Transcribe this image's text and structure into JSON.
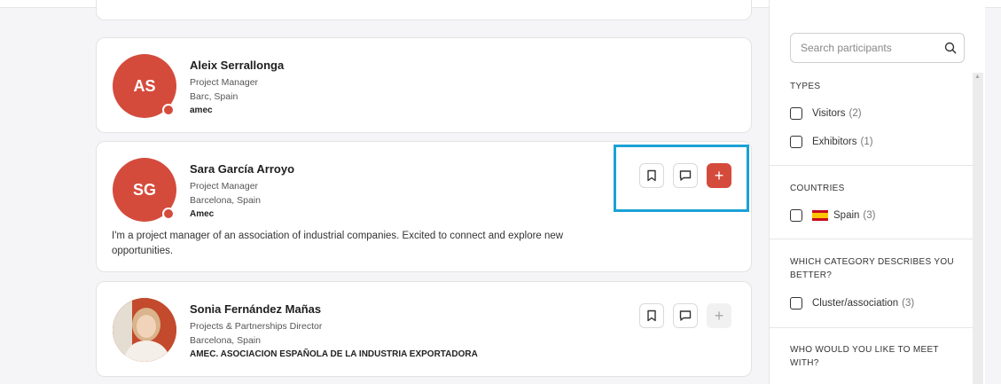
{
  "participants": [
    {
      "initials": "AS",
      "name": "Aleix Serrallonga",
      "title": "Project Manager",
      "location": "Barc, Spain",
      "company": "amec"
    },
    {
      "initials": "SG",
      "name": "Sara García Arroyo",
      "title": "Project Manager",
      "location": "Barcelona, Spain",
      "company": "Amec",
      "bio": "I'm a project manager of an association of industrial companies. Excited to connect and explore new opportunities."
    },
    {
      "name": "Sonia Fernández Mañas",
      "title": "Projects & Partnerships Director",
      "location": "Barcelona, Spain",
      "company": "AMEC. ASOCIACION ESPAÑOLA DE LA INDUSTRIA EXPORTADORA"
    }
  ],
  "actions": {
    "add_symbol": "+"
  },
  "filters": {
    "search_placeholder": "Search participants",
    "types": {
      "title": "TYPES",
      "options": [
        {
          "label": "Visitors",
          "count": "(2)"
        },
        {
          "label": "Exhibitors",
          "count": "(1)"
        }
      ]
    },
    "countries": {
      "title": "COUNTRIES",
      "options": [
        {
          "label": "Spain",
          "count": "(3)"
        }
      ]
    },
    "category": {
      "title": "WHICH CATEGORY DESCRIBES YOU BETTER?",
      "options": [
        {
          "label": "Cluster/association",
          "count": "(3)"
        }
      ]
    },
    "meet": {
      "title": "WHO WOULD YOU LIKE TO MEET WITH?"
    }
  },
  "colors": {
    "accent": "#d44b3c",
    "highlight": "#1ba1d6"
  },
  "icons": [
    "search-icon",
    "bookmark-icon",
    "chat-icon",
    "plus-icon",
    "spain-flag-icon"
  ]
}
